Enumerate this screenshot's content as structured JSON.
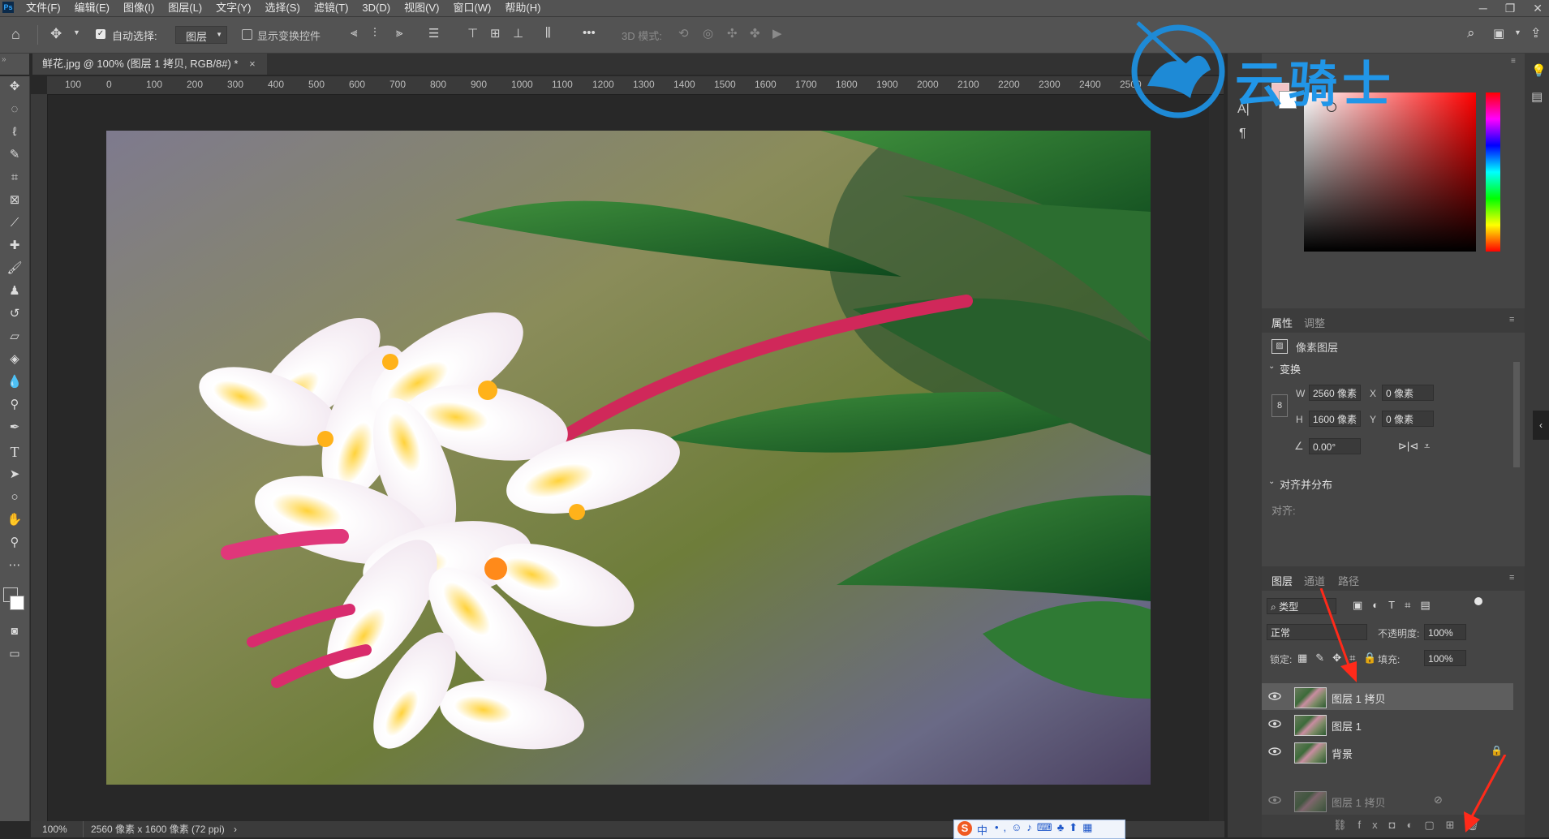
{
  "menubar": {
    "logo": "Ps",
    "items": [
      "文件(F)",
      "编辑(E)",
      "图像(I)",
      "图层(L)",
      "文字(Y)",
      "选择(S)",
      "滤镜(T)",
      "3D(D)",
      "视图(V)",
      "窗口(W)",
      "帮助(H)"
    ]
  },
  "options": {
    "auto_select_label": "自动选择:",
    "auto_select_checked": true,
    "auto_select_target": "图层",
    "show_transform_label": "显示变换控件",
    "mode_3d_label": "3D 模式:",
    "more": "•••"
  },
  "document": {
    "tab_title": "鲜花.jpg @ 100% (图层 1 拷贝, RGB/8#) *",
    "close": "×"
  },
  "ruler_h": [
    "100",
    "0",
    "100",
    "200",
    "300",
    "400",
    "500",
    "600",
    "700",
    "800",
    "900",
    "1000",
    "1100",
    "1200",
    "1300",
    "1400",
    "1500",
    "1600",
    "1700",
    "1800",
    "1900",
    "2000",
    "2100",
    "2200",
    "2300",
    "2400",
    "2500"
  ],
  "status": {
    "zoom": "100%",
    "doc_info": "2560 像素 x 1600 像素 (72 ppi)",
    "arrow": "›"
  },
  "watermark": {
    "text": "云骑士"
  },
  "color_panel": {
    "foreground": "#f2c4c6",
    "background": "#ffffff"
  },
  "properties": {
    "tab_active": "属性",
    "tab_other": "调整",
    "layer_kind": "像素图层",
    "transform_title": "变换",
    "w_label": "W",
    "w_value": "2560 像素",
    "x_label": "X",
    "x_value": "0 像素",
    "h_label": "H",
    "h_value": "1600 像素",
    "y_label": "Y",
    "y_value": "0 像素",
    "angle_value": "0.00°",
    "align_title": "对齐并分布",
    "align_label": "对齐:"
  },
  "layers": {
    "tabs": [
      "图层",
      "通道",
      "路径"
    ],
    "filter_kind": "类型",
    "blend_mode": "正常",
    "opacity_label": "不透明度:",
    "opacity_value": "100%",
    "lock_label": "锁定:",
    "fill_label": "填充:",
    "fill_value": "100%",
    "rows": [
      {
        "name": "图层 1 拷贝",
        "selected": true,
        "locked": false
      },
      {
        "name": "图层 1",
        "selected": false,
        "locked": false
      },
      {
        "name": "背景",
        "selected": false,
        "locked": true
      }
    ],
    "drag_ghost_name": "图层 1 拷贝"
  },
  "ime": {
    "lang": "中"
  }
}
